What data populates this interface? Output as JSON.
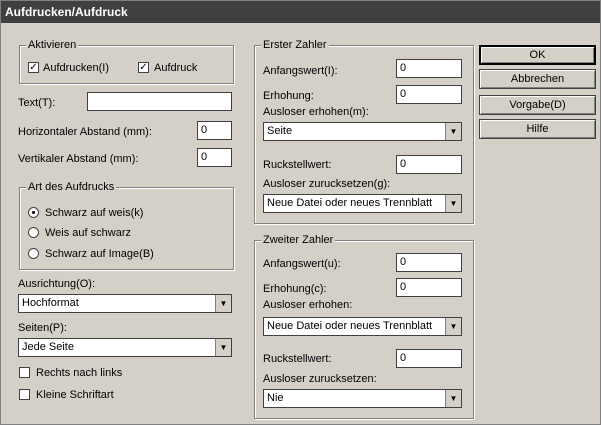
{
  "window": {
    "title": "Aufdrucken/Aufdruck"
  },
  "aktivieren": {
    "legend": "Aktivieren",
    "aufdrucken": {
      "label": "Aufdrucken(I)",
      "checked": "✓"
    },
    "aufdruck": {
      "label": "Aufdruck",
      "checked": "✓"
    }
  },
  "text_field": {
    "label": "Text(T):",
    "value": ""
  },
  "horizontal": {
    "label": "Horizontaler Abstand (mm):",
    "value": "0"
  },
  "vertikal": {
    "label": "Vertikaler Abstand (mm):",
    "value": "0"
  },
  "art": {
    "legend": "Art des Aufdrucks",
    "options": [
      "Schwarz auf weis(k)",
      "Weis auf schwarz",
      "Schwarz auf Image(B)"
    ],
    "selected_index": 0
  },
  "ausrichtung": {
    "label": "Ausrichtung(O):",
    "value": "Hochformat"
  },
  "seiten": {
    "label": "Seiten(P):",
    "value": "Jede Seite"
  },
  "rechts": {
    "label": "Rechts nach links",
    "checked": ""
  },
  "kleine": {
    "label": "Kleine Schriftart",
    "checked": ""
  },
  "erster": {
    "legend": "Erster Zahler",
    "anfangswert": {
      "label": "Anfangswert(I):",
      "value": "0"
    },
    "erhohung": {
      "label": "Erhohung:",
      "value": "0"
    },
    "ausloser_erhohen": {
      "label": "Ausloser erhohen(m):",
      "value": "Seite"
    },
    "ruckstellwert": {
      "label": "Ruckstellwert:",
      "value": "0"
    },
    "ausloser_zuruck": {
      "label": "Ausloser zurucksetzen(g):",
      "value": "Neue Datei oder neues Trennblatt"
    }
  },
  "zweiter": {
    "legend": "Zweiter Zahler",
    "anfangswert": {
      "label": "Anfangswert(u):",
      "value": "0"
    },
    "erhohung": {
      "label": "Erhohung(c):",
      "value": "0"
    },
    "ausloser_erhohen": {
      "label": "Ausloser erhohen:",
      "value": "Neue Datei oder neues Trennblatt"
    },
    "ruckstellwert": {
      "label": "Ruckstellwert:",
      "value": "0"
    },
    "ausloser_zuruck": {
      "label": "Ausloser zurucksetzen:",
      "value": "Nie"
    }
  },
  "buttons": {
    "ok": "OK",
    "abbrechen": "Abbrechen",
    "vorgabe": "Vorgabe(D)",
    "hilfe": "Hilfe"
  },
  "icons": {
    "dropdown": "▼"
  }
}
